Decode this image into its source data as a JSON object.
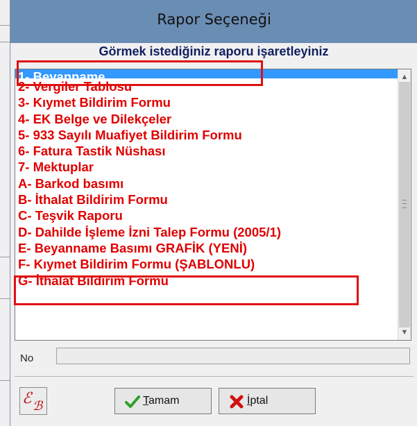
{
  "window": {
    "title": "Rapor Seçeneği"
  },
  "heading": "Görmek istediğiniz raporu işaretleyiniz",
  "report_list": {
    "items": [
      {
        "label": "1- Beyanname",
        "selected": true
      },
      {
        "label": "2- Vergiler Tablosu"
      },
      {
        "label": "3- Kıymet Bildirim Formu"
      },
      {
        "label": "4- EK Belge ve Dilekçeler"
      },
      {
        "label": "5- 933 Sayılı Muafiyet Bildirim Formu"
      },
      {
        "label": "6- Fatura Tastik Nüshası"
      },
      {
        "label": "7- Mektuplar"
      },
      {
        "label": "A- Barkod basımı"
      },
      {
        "label": "B- İthalat Bildirim Formu"
      },
      {
        "label": "C- Teşvik Raporu"
      },
      {
        "label": "D- Dahilde İşleme İzni Talep Formu (2005/1)"
      },
      {
        "label": "E- Beyanname Basımı GRAFİK (YENİ)"
      },
      {
        "label": "F- Kıymet Bildirim Formu (ŞABLONLU)"
      },
      {
        "label": "G- İthalat Bildirim Formu"
      }
    ]
  },
  "no_field": {
    "label": "No",
    "value": ""
  },
  "buttons": {
    "ok": {
      "mnemonic": "T",
      "rest": "amam"
    },
    "cancel": {
      "mnemonic": "İ",
      "rest": "ptal"
    }
  },
  "colors": {
    "titlebar": "#6a8db4",
    "item_text": "#e00000",
    "selection": "#3399ff",
    "highlight_box": "#e01010"
  }
}
